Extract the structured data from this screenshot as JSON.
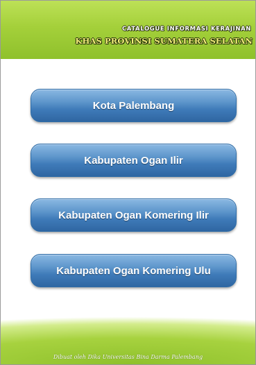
{
  "header": {
    "subtitle": "CATALOGUE INFORMASI KERAJINAN",
    "title": "KHAS PROVINSI SUMATERA SELATAN",
    "background_color": "#a4d03a"
  },
  "menu": {
    "items": [
      {
        "label": "Kota Palembang"
      },
      {
        "label": "Kabupaten Ogan Ilir"
      },
      {
        "label": "Kabupaten Ogan Komering Ilir"
      },
      {
        "label": "Kabupaten Ogan Komering Ulu"
      }
    ],
    "button_color": "#3f7bb9"
  },
  "footer": {
    "credit": "Dibuat oleh Dika Universitas Bina Darma Palembang"
  }
}
